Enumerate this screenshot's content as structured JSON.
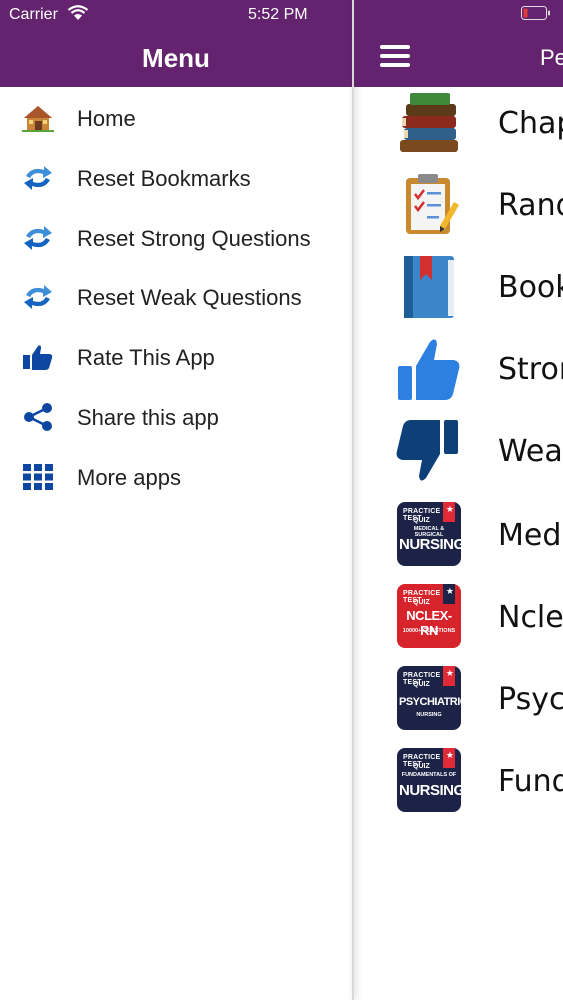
{
  "status_bar": {
    "carrier": "Carrier",
    "time": "5:52 PM"
  },
  "drawer": {
    "title": "Menu",
    "items": [
      {
        "label": "Home",
        "icon": "home-icon"
      },
      {
        "label": "Reset Bookmarks",
        "icon": "reset-arrows-icon"
      },
      {
        "label": "Reset Strong Questions",
        "icon": "reset-arrows-icon"
      },
      {
        "label": "Reset Weak Questions",
        "icon": "reset-arrows-icon"
      },
      {
        "label": "Rate This App",
        "icon": "thumbs-up-icon"
      },
      {
        "label": "Share this app",
        "icon": "share-icon"
      },
      {
        "label": "More apps",
        "icon": "grid-icon"
      }
    ]
  },
  "main": {
    "title": "Pe",
    "items": [
      {
        "label": "Chap",
        "icon": "books-icon"
      },
      {
        "label": "Rand",
        "icon": "clipboard-icon"
      },
      {
        "label": "Bookr",
        "icon": "bookmark-book-icon"
      },
      {
        "label": "Stron",
        "icon": "thumbs-up-icon"
      },
      {
        "label": "Weak",
        "icon": "thumbs-down-icon"
      },
      {
        "label": "Medi",
        "icon": "app-badge-icon",
        "badge": {
          "line1": "PRACTICE TEST",
          "line2": "QUIZ",
          "line3": "MEDICAL & SURGICAL",
          "line4": "NURSING"
        }
      },
      {
        "label": "Nclex",
        "icon": "app-badge-icon",
        "badge": {
          "line1": "PRACTICE TEST",
          "line2": "QUIZ",
          "line3": "10000+ QUESTIONS",
          "line4": "NCLEX-RN"
        }
      },
      {
        "label": "Psych",
        "icon": "app-badge-icon",
        "badge": {
          "line1": "PRACTICE TEST",
          "line2": "QUIZ",
          "line3": "NURSING",
          "line4": "PSYCHIATRIC"
        }
      },
      {
        "label": "Funda",
        "icon": "app-badge-icon",
        "badge": {
          "line1": "PRACTICE TEST",
          "line2": "QUIZ",
          "line3": "FUNDAMENTALS OF",
          "line4": "NURSING"
        }
      }
    ]
  },
  "colors": {
    "header": "#63236f",
    "icon_blue": "#1565c0",
    "badge_navy": "#1d2347",
    "badge_red": "#d7232c"
  }
}
